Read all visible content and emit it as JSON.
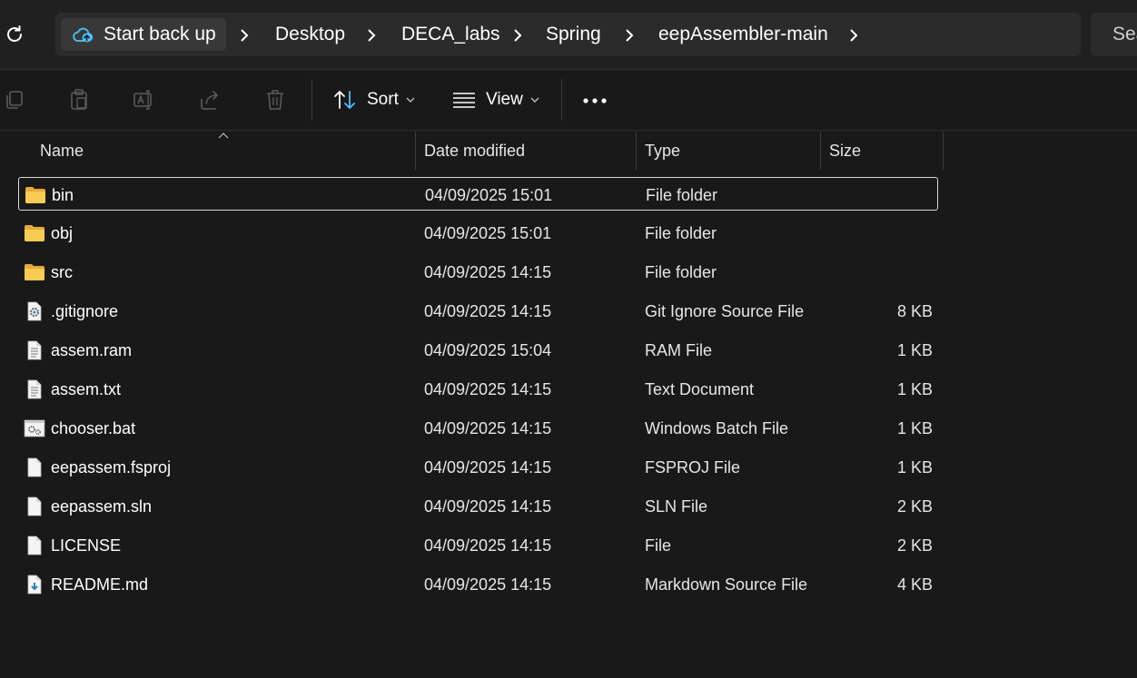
{
  "address_bar": {
    "home_label": "Start back up",
    "crumbs": [
      "Desktop",
      "DECA_labs",
      "Spring",
      "eepAssembler-main"
    ],
    "search_placeholder": "Sea"
  },
  "command_bar": {
    "sort_label": "Sort",
    "view_label": "View"
  },
  "columns": {
    "name": "Name",
    "date": "Date modified",
    "type": "Type",
    "size": "Size"
  },
  "files": [
    {
      "name": "bin",
      "date": "04/09/2025 15:01",
      "type": "File folder",
      "size": "",
      "icon": "folder-icon",
      "selected": true
    },
    {
      "name": "obj",
      "date": "04/09/2025 15:01",
      "type": "File folder",
      "size": "",
      "icon": "folder-icon"
    },
    {
      "name": "src",
      "date": "04/09/2025 14:15",
      "type": "File folder",
      "size": "",
      "icon": "folder-icon"
    },
    {
      "name": ".gitignore",
      "date": "04/09/2025 14:15",
      "type": "Git Ignore Source File",
      "size": "8 KB",
      "icon": "settings-file-icon"
    },
    {
      "name": "assem.ram",
      "date": "04/09/2025 15:04",
      "type": "RAM File",
      "size": "1 KB",
      "icon": "text-file-icon"
    },
    {
      "name": "assem.txt",
      "date": "04/09/2025 14:15",
      "type": "Text Document",
      "size": "1 KB",
      "icon": "text-file-icon"
    },
    {
      "name": "chooser.bat",
      "date": "04/09/2025 14:15",
      "type": "Windows Batch File",
      "size": "1 KB",
      "icon": "batch-file-icon"
    },
    {
      "name": "eepassem.fsproj",
      "date": "04/09/2025 14:15",
      "type": "FSPROJ File",
      "size": "1 KB",
      "icon": "blank-file-icon"
    },
    {
      "name": "eepassem.sln",
      "date": "04/09/2025 14:15",
      "type": "SLN File",
      "size": "2 KB",
      "icon": "blank-file-icon"
    },
    {
      "name": "LICENSE",
      "date": "04/09/2025 14:15",
      "type": "File",
      "size": "2 KB",
      "icon": "blank-file-icon"
    },
    {
      "name": "README.md",
      "date": "04/09/2025 14:15",
      "type": "Markdown Source File",
      "size": "4 KB",
      "icon": "markdown-file-icon"
    }
  ],
  "colors": {
    "background": "#191919",
    "bar": "#202020",
    "folder": "#f3c244",
    "accent": "#4cc2ff"
  }
}
